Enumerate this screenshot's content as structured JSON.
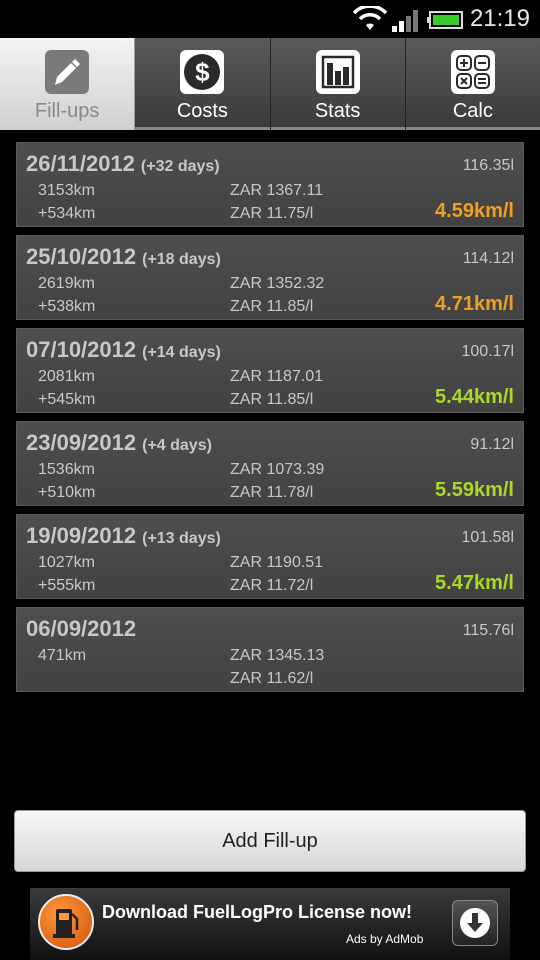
{
  "status_bar": {
    "time": "21:19"
  },
  "tabs": [
    {
      "label": "Fill-ups",
      "icon": "pen-icon",
      "active": true
    },
    {
      "label": "Costs",
      "icon": "dollar-icon",
      "active": false
    },
    {
      "label": "Stats",
      "icon": "bar-chart-icon",
      "active": false
    },
    {
      "label": "Calc",
      "icon": "calculator-icon",
      "active": false
    }
  ],
  "entries": [
    {
      "date": "26/11/2012",
      "days": "(+32 days)",
      "volume": "116.35l",
      "odometer": "3153km",
      "distance": "+534km",
      "cost": "ZAR 1367.11",
      "price": "ZAR 11.75/l",
      "efficiency": "4.59km/l",
      "efficiency_color": "#f0a020"
    },
    {
      "date": "25/10/2012",
      "days": "(+18 days)",
      "volume": "114.12l",
      "odometer": "2619km",
      "distance": "+538km",
      "cost": "ZAR 1352.32",
      "price": "ZAR 11.85/l",
      "efficiency": "4.71km/l",
      "efficiency_color": "#f0a020"
    },
    {
      "date": "07/10/2012",
      "days": "(+14 days)",
      "volume": "100.17l",
      "odometer": "2081km",
      "distance": "+545km",
      "cost": "ZAR 1187.01",
      "price": "ZAR 11.85/l",
      "efficiency": "5.44km/l",
      "efficiency_color": "#a8d82a"
    },
    {
      "date": "23/09/2012",
      "days": "(+4 days)",
      "volume": "91.12l",
      "odometer": "1536km",
      "distance": "+510km",
      "cost": "ZAR 1073.39",
      "price": "ZAR 11.78/l",
      "efficiency": "5.59km/l",
      "efficiency_color": "#a8d82a"
    },
    {
      "date": "19/09/2012",
      "days": "(+13 days)",
      "volume": "101.58l",
      "odometer": "1027km",
      "distance": "+555km",
      "cost": "ZAR 1190.51",
      "price": "ZAR 11.72/l",
      "efficiency": "5.47km/l",
      "efficiency_color": "#a8d82a"
    },
    {
      "date": "06/09/2012",
      "days": "",
      "volume": "115.76l",
      "odometer": "471km",
      "distance": "",
      "cost": "ZAR 1345.13",
      "price": "ZAR 11.62/l",
      "efficiency": "",
      "efficiency_color": "#a8d82a"
    }
  ],
  "add_button": {
    "label": "Add Fill-up"
  },
  "ad": {
    "title": "Download FuelLogPro License now!",
    "subtitle": "Ads by AdMob"
  }
}
